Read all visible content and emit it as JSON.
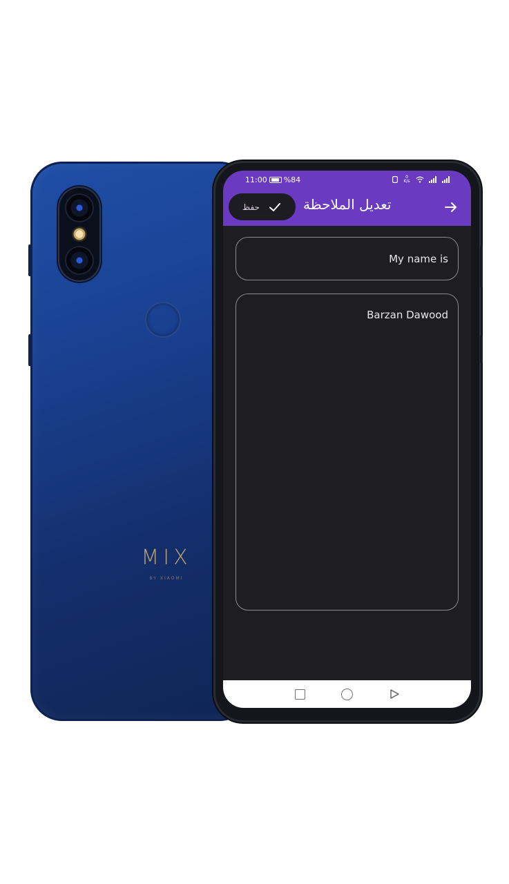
{
  "status_bar": {
    "time": "11:00",
    "battery": "%84",
    "net_speed": "0 K/s",
    "icons": [
      "battery-icon",
      "sim-icon",
      "wifi-icon",
      "signal-icon",
      "signal-icon"
    ]
  },
  "app_bar": {
    "title": "تعديل الملاحظة",
    "save_label": "حفظ",
    "icons": {
      "save": "check-icon",
      "back": "arrow-right-icon"
    },
    "colors": {
      "bar": "#6a3bc0",
      "chip": "#1d1c22"
    }
  },
  "note": {
    "title_value": "My name is",
    "body_value": "Barzan Dawood"
  },
  "device": {
    "brand_logo": "MIX",
    "brand_sub": "BY XIAOMI",
    "body_color": "#1a3f8f"
  },
  "nav_bar": {
    "icons": [
      "recents-square-icon",
      "home-circle-icon",
      "back-triangle-icon"
    ]
  }
}
